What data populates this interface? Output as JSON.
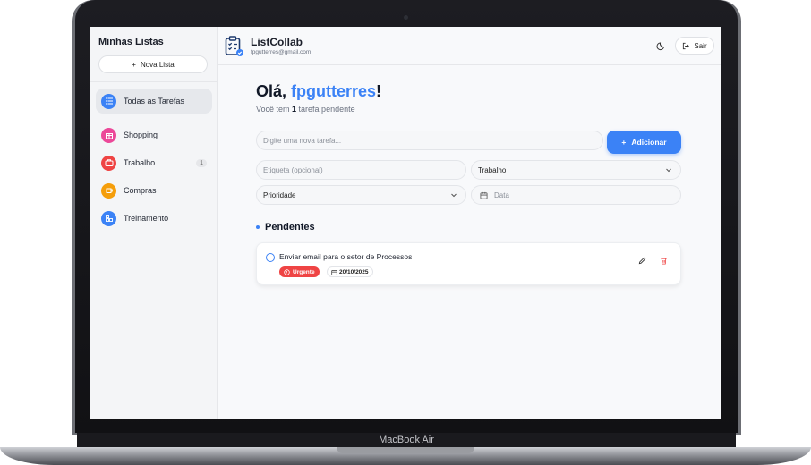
{
  "device": {
    "label": "MacBook Air"
  },
  "sidebar": {
    "title": "Minhas Listas",
    "new_list_label": "Nova Lista",
    "items": [
      {
        "label": "Todas as Tarefas",
        "icon": "list-icon",
        "color": "#3b82f6",
        "active": true,
        "count": ""
      },
      {
        "label": "Shopping",
        "icon": "gift-icon",
        "color": "#ec4899",
        "count": ""
      },
      {
        "label": "Trabalho",
        "icon": "briefcase-icon",
        "color": "#ef4444",
        "count": "1"
      },
      {
        "label": "Compras",
        "icon": "cup-icon",
        "color": "#f59e0b",
        "count": ""
      },
      {
        "label": "Treinamento",
        "icon": "blocks-icon",
        "color": "#3b82f6",
        "count": ""
      }
    ]
  },
  "header": {
    "app_name": "ListCollab",
    "email": "fpgutterres@gmail.com",
    "logout_label": "Sair"
  },
  "main": {
    "greeting_prefix": "Olá, ",
    "user_name": "fpgutterres",
    "greeting_suffix": "!",
    "subtitle_prefix": "Você tem ",
    "pending_count": "1",
    "subtitle_suffix": " tarefa pendente",
    "task_input_placeholder": "Digite uma nova tarefa...",
    "add_button_label": "Adicionar",
    "tag_placeholder": "Etiqueta (opcional)",
    "list_select_value": "Trabalho",
    "priority_placeholder": "Prioridade",
    "date_placeholder": "Data",
    "section_title": "Pendentes"
  },
  "tasks": [
    {
      "title": "Enviar email para o setor de Processos",
      "priority": "Urgente",
      "date": "20/10/2025"
    }
  ],
  "colors": {
    "accent": "#3b82f6",
    "urgent": "#ef4444"
  }
}
